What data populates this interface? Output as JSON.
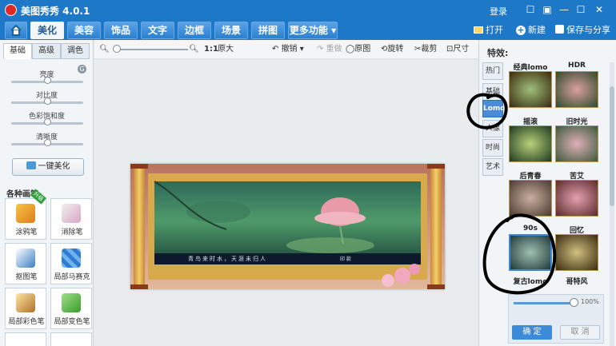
{
  "app": {
    "title": "美图秀秀 4.0.1",
    "login": "登录"
  },
  "window_controls": {
    "msg": "☐",
    "min": "—",
    "max": "☐",
    "close": "✕"
  },
  "menu": {
    "tabs": [
      "美化",
      "美容",
      "饰品",
      "文字",
      "边框",
      "场景",
      "拼图",
      "更多功能 ▾"
    ],
    "active": "美化"
  },
  "actions": {
    "open": "打开",
    "new": "新建",
    "save": "保存与分享"
  },
  "left": {
    "tabs": [
      "基础",
      "高级",
      "调色"
    ],
    "sliders": [
      {
        "label": "亮度",
        "level": 0.5
      },
      {
        "label": "对比度",
        "level": 0.5
      },
      {
        "label": "色彩饱和度",
        "level": 0.5
      },
      {
        "label": "清晰度",
        "level": 0.5
      }
    ],
    "onekey_label": "一键美化",
    "brushes_title": "各种画笔",
    "tools": [
      "涂鸦笔",
      "消除笔",
      "抠图笔",
      "局部马赛克",
      "局部彩色笔",
      "局部变色笔"
    ],
    "badge": "升级"
  },
  "canvas_toolbar": {
    "zoom_one": "1:1",
    "original_size": "原大",
    "undo": "撤销",
    "redo": "重做",
    "original": "原图",
    "rotate": "旋转",
    "crop": "裁剪",
    "size": "尺寸"
  },
  "photo": {
    "caption": "青鸟来时水，天涯未归人",
    "seal": "印 款"
  },
  "right": {
    "title": "特效:",
    "categories": [
      "热门",
      "基础",
      "Lomo",
      "人像",
      "时尚",
      "艺术"
    ],
    "active_category": "Lomo",
    "effects": [
      {
        "name": "经典lomo"
      },
      {
        "name": "HDR"
      },
      {
        "name": "摇滚"
      },
      {
        "name": "旧时光"
      },
      {
        "name": "后青春"
      },
      {
        "name": "苦艾"
      },
      {
        "name": "90s"
      },
      {
        "name": "回忆"
      },
      {
        "name": "复古lomo"
      },
      {
        "name": "哥特风"
      }
    ],
    "selected_effect": "复古lomo",
    "strength_percent": 100,
    "strength_label": "100%",
    "ok": "确 定",
    "cancel": "取 消"
  }
}
